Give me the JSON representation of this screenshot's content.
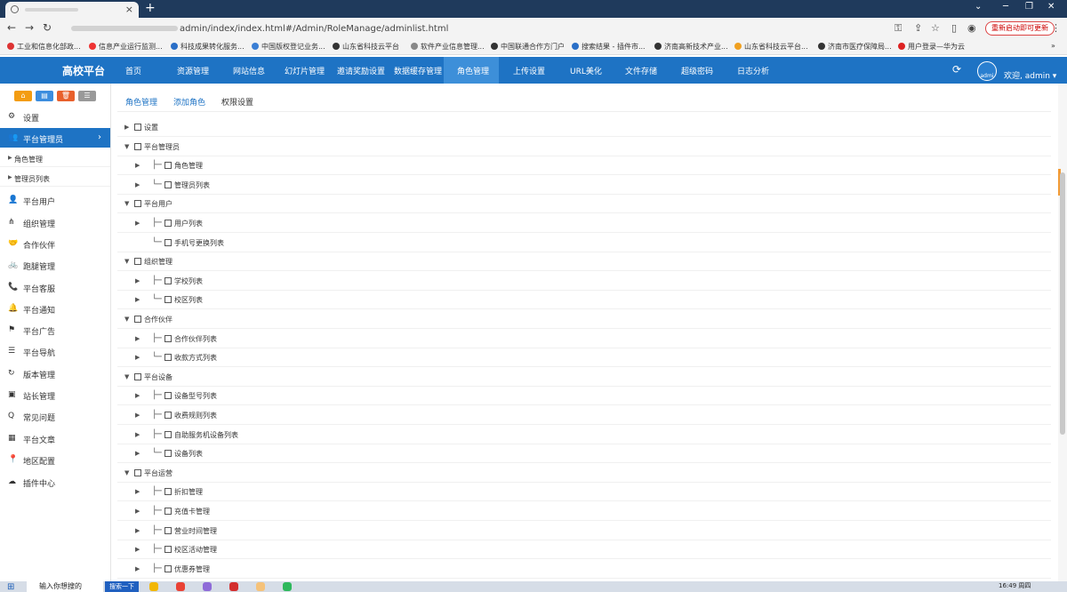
{
  "browser": {
    "url_path": "admin/index/index.html#/Admin/RoleManage/adminlist.html",
    "update_button": "重新启动即可更新",
    "bookmarks": [
      "工业和信息化部政...",
      "信息产业运行监测...",
      "科技成果转化服务...",
      "中国版权登记业务...",
      "山东省科技云平台",
      "软件产业信息管理...",
      "中国联通合作方门户",
      "搜索结果 - 插件市...",
      "济南高新技术产业...",
      "山东省科技云平台...",
      "济南市医疗保障局...",
      "用户登录—华为云"
    ]
  },
  "app": {
    "brand": "高校平台",
    "nav": [
      "首页",
      "资源管理",
      "网站信息",
      "幻灯片管理",
      "邀请奖励设置",
      "数据缓存管理",
      "角色管理",
      "上传设置",
      "URL美化",
      "文件存储",
      "超级密码",
      "日志分析"
    ],
    "avatar_text": "admi",
    "welcome": "欢迎, admin ▾"
  },
  "sidebar": {
    "items": [
      {
        "label": "设置",
        "icon": "⚙"
      },
      {
        "label": "平台管理员",
        "icon": "👥"
      },
      {
        "label": "角色管理",
        "icon": ""
      },
      {
        "label": "管理员列表",
        "icon": ""
      },
      {
        "label": "平台用户",
        "icon": "👤"
      },
      {
        "label": "组织管理",
        "icon": "⋔"
      },
      {
        "label": "合作伙伴",
        "icon": "🤝"
      },
      {
        "label": "跑腿管理",
        "icon": "🚲"
      },
      {
        "label": "平台客服",
        "icon": "📞"
      },
      {
        "label": "平台通知",
        "icon": "🔔"
      },
      {
        "label": "平台广告",
        "icon": "⚑"
      },
      {
        "label": "平台导航",
        "icon": "☰"
      },
      {
        "label": "版本管理",
        "icon": "↻"
      },
      {
        "label": "站长管理",
        "icon": "▣"
      },
      {
        "label": "常见问题",
        "icon": "Q"
      },
      {
        "label": "平台文章",
        "icon": "▦"
      },
      {
        "label": "地区配置",
        "icon": "📍"
      },
      {
        "label": "插件中心",
        "icon": "☁"
      }
    ]
  },
  "main": {
    "tabs": [
      "角色管理",
      "添加角色",
      "权限设置"
    ],
    "tree": [
      {
        "label": "设置",
        "level": 0,
        "arrow": "▶"
      },
      {
        "label": "平台管理员",
        "level": 0,
        "arrow": "▼"
      },
      {
        "label": "角色管理",
        "level": 1,
        "arrow": "▶",
        "line": "├─"
      },
      {
        "label": "管理员列表",
        "level": 1,
        "arrow": "▶",
        "line": "└─"
      },
      {
        "label": "平台用户",
        "level": 0,
        "arrow": "▼"
      },
      {
        "label": "用户列表",
        "level": 1,
        "arrow": "▶",
        "line": "├─"
      },
      {
        "label": "手机号更换列表",
        "level": 1,
        "arrow": "",
        "line": "└─"
      },
      {
        "label": "组织管理",
        "level": 0,
        "arrow": "▼"
      },
      {
        "label": "学校列表",
        "level": 1,
        "arrow": "▶",
        "line": "├─"
      },
      {
        "label": "校区列表",
        "level": 1,
        "arrow": "▶",
        "line": "└─"
      },
      {
        "label": "合作伙伴",
        "level": 0,
        "arrow": "▼"
      },
      {
        "label": "合作伙伴列表",
        "level": 1,
        "arrow": "▶",
        "line": "├─"
      },
      {
        "label": "收款方式列表",
        "level": 1,
        "arrow": "▶",
        "line": "└─"
      },
      {
        "label": "平台设备",
        "level": 0,
        "arrow": "▼"
      },
      {
        "label": "设备型号列表",
        "level": 1,
        "arrow": "▶",
        "line": "├─"
      },
      {
        "label": "收费规则列表",
        "level": 1,
        "arrow": "▶",
        "line": "├─"
      },
      {
        "label": "自助服务机设备列表",
        "level": 1,
        "arrow": "▶",
        "line": "├─"
      },
      {
        "label": "设备列表",
        "level": 1,
        "arrow": "▶",
        "line": "└─"
      },
      {
        "label": "平台运营",
        "level": 0,
        "arrow": "▼"
      },
      {
        "label": "折扣管理",
        "level": 1,
        "arrow": "▶",
        "line": "├─"
      },
      {
        "label": "充值卡管理",
        "level": 1,
        "arrow": "▶",
        "line": "├─"
      },
      {
        "label": "营业时间管理",
        "level": 1,
        "arrow": "▶",
        "line": "├─"
      },
      {
        "label": "校区活动管理",
        "level": 1,
        "arrow": "▶",
        "line": "├─"
      },
      {
        "label": "优惠券管理",
        "level": 1,
        "arrow": "▶",
        "line": "├─"
      }
    ]
  },
  "taskbar": {
    "search": "输入你想搜的",
    "search_button": "搜索一下",
    "time": "16:49 周四"
  },
  "colors": {
    "header": "#1e73c4",
    "nav_active": "#3d8fd9",
    "link": "#1e73c4"
  }
}
